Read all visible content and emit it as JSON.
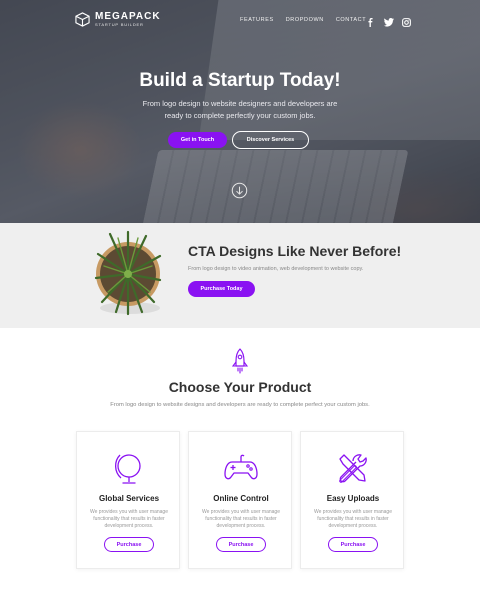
{
  "brand": {
    "name": "MEGAPACK",
    "tagline": "STARTUP BUILDER"
  },
  "nav": {
    "items": [
      "FEATURES",
      "DROPDOWN",
      "CONTACT"
    ]
  },
  "social": [
    "facebook-icon",
    "twitter-icon",
    "instagram-icon"
  ],
  "hero": {
    "title": "Build a Startup Today!",
    "subtitle": "From logo design to website designers and developers are ready to complete perfectly your custom jobs.",
    "primary_button": "Get in Touch",
    "secondary_button": "Discover Services"
  },
  "cta": {
    "title": "CTA Designs Like Never Before!",
    "subtitle": "From logo design to video animation, web development to website copy.",
    "button": "Purchase Today"
  },
  "products": {
    "title": "Choose Your Product",
    "subtitle": "From logo design to website designs and developers are ready to complete perfect your custom jobs.",
    "cards": [
      {
        "icon": "globe-icon",
        "title": "Global Services",
        "desc": "We provides you with user manage functionality that results in faster development process.",
        "button": "Purchase"
      },
      {
        "icon": "gamepad-icon",
        "title": "Online Control",
        "desc": "We provides you with user manage functionality that results in faster development process.",
        "button": "Purchase"
      },
      {
        "icon": "tools-icon",
        "title": "Easy Uploads",
        "desc": "We provides you with user manage functionality that results in faster development process.",
        "button": "Purchase"
      }
    ]
  },
  "colors": {
    "accent": "#8a12f2",
    "cta_bg": "#efefef"
  }
}
